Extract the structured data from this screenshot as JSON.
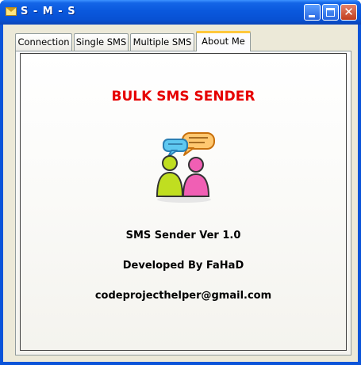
{
  "window": {
    "title": "S - M - S"
  },
  "titlebar": {
    "close_glyph": "✕"
  },
  "tabs": [
    {
      "label": "Connection"
    },
    {
      "label": "Single SMS"
    },
    {
      "label": "Multiple SMS"
    },
    {
      "label": "About Me",
      "selected": true
    }
  ],
  "about": {
    "heading": "BULK SMS SENDER",
    "heading_color": "#e60000",
    "logo_icon": "chat-people-icon",
    "version": "SMS Sender Ver 1.0",
    "developer": "Developed By FaHaD",
    "email": "codeprojecthelper@gmail.com"
  }
}
